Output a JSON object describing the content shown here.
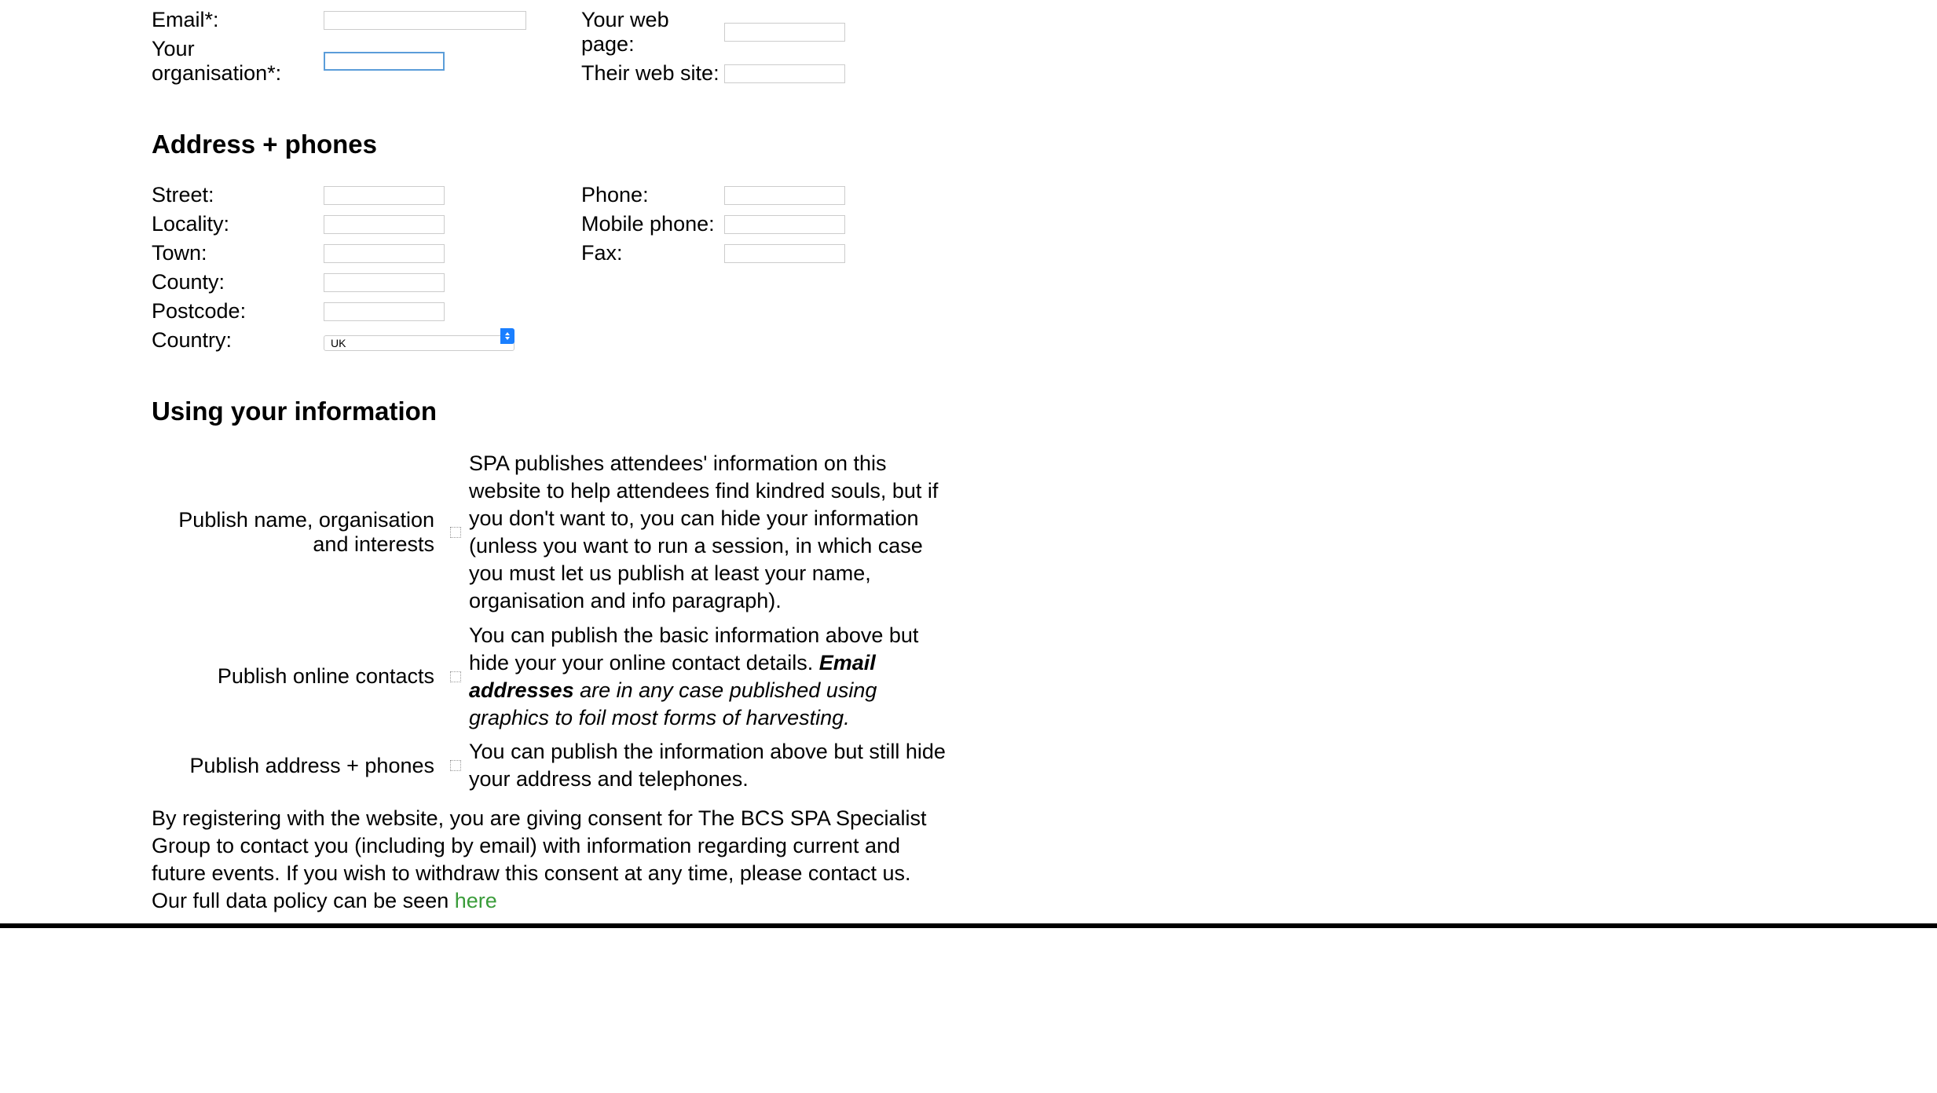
{
  "top": {
    "email_label": "Email*:",
    "email_value": "",
    "web_label": "Your web page:",
    "web_value": "",
    "org_label": "Your organisation*:",
    "org_value": "",
    "their_web_label": "Their web site:",
    "their_web_value": ""
  },
  "address": {
    "heading": "Address + phones",
    "street_label": "Street:",
    "street_value": "",
    "locality_label": "Locality:",
    "locality_value": "",
    "town_label": "Town:",
    "town_value": "",
    "county_label": "County:",
    "county_value": "",
    "postcode_label": "Postcode:",
    "postcode_value": "",
    "country_label": "Country:",
    "country_value": "UK",
    "phone_label": "Phone:",
    "phone_value": "",
    "mobile_label": "Mobile phone:",
    "mobile_value": "",
    "fax_label": "Fax:",
    "fax_value": ""
  },
  "using": {
    "heading": "Using your information",
    "row1_label": "Publish name, organisation and interests",
    "row1_text": "SPA publishes attendees' information on this website to help attendees find kindred souls, but if you don't want to, you can hide your information (unless you want to run a session, in which case you must let us publish at least your name, organisation and info paragraph).",
    "row2_label": "Publish online contacts",
    "row2_text_a": "You can publish the basic information above but hide your your online contact details. ",
    "row2_text_b": "Email addresses",
    "row2_text_c": " are in any case published using graphics to foil most forms of harvesting.",
    "row3_label": "Publish address + phones",
    "row3_text": "You can publish the information above but still hide your address and telephones.",
    "consent_a": "By registering with the website, you are giving consent for The BCS SPA Specialist Group to contact you (including by email) with information regarding current and future events. If you wish to withdraw this consent at any time, please contact us. Our full data policy can be seen ",
    "consent_link": "here"
  }
}
